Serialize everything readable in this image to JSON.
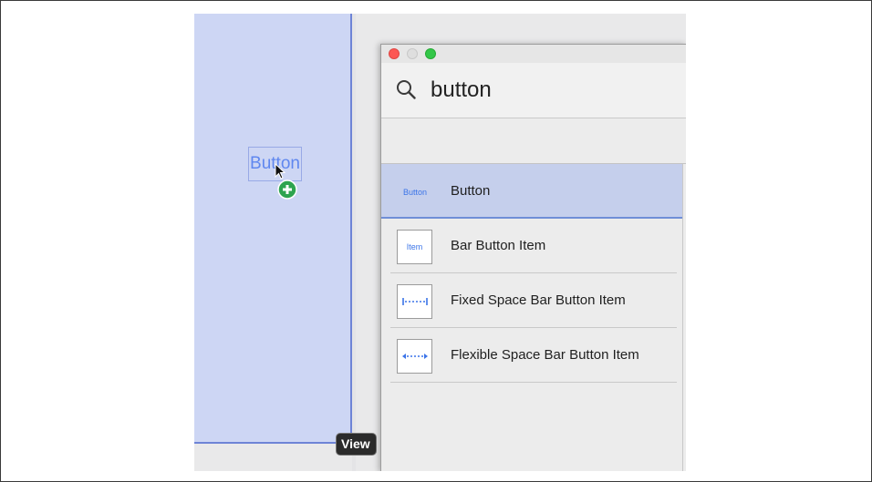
{
  "canvas": {
    "button_text": "Button",
    "tooltip": "View"
  },
  "library": {
    "search": {
      "value": "button",
      "icon": "magnifying-glass"
    },
    "items": [
      {
        "thumb": "Button",
        "label": "Button",
        "selected": true
      },
      {
        "thumb": "Item",
        "label": "Bar Button Item",
        "selected": false
      },
      {
        "thumb": "fixed-space-icon",
        "label": "Fixed Space Bar Button Item",
        "selected": false
      },
      {
        "thumb": "flexible-space-icon",
        "label": "Flexible Space Bar Button Item",
        "selected": false
      }
    ]
  },
  "colors": {
    "canvas_bg": "#cdd6f4",
    "canvas_border": "#6e84d6",
    "accent_blue": "#3b74e8",
    "selection_bg": "#c5cfec",
    "add_badge_green": "#2ea44f",
    "close": "#fc5753",
    "maximize": "#33c748"
  }
}
